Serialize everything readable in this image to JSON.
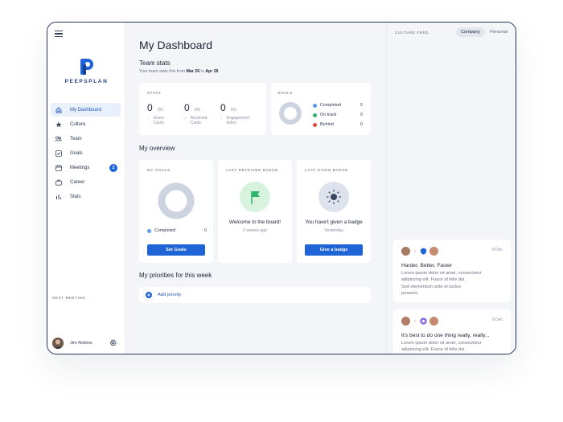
{
  "brand": {
    "name": "PEEPSPLAN"
  },
  "sidebar": {
    "items": [
      {
        "label": "My Dashboard",
        "icon": "home-icon",
        "active": true
      },
      {
        "label": "Culture",
        "icon": "star-icon"
      },
      {
        "label": "Team",
        "icon": "team-icon"
      },
      {
        "label": "Goals",
        "icon": "goals-icon"
      },
      {
        "label": "Meetings",
        "icon": "calendar-icon",
        "badge": "2"
      },
      {
        "label": "Career",
        "icon": "briefcase-icon"
      },
      {
        "label": "Stats",
        "icon": "stats-icon"
      }
    ],
    "next_meeting_label": "NEXT MEETING",
    "user_name": "Jim Robins"
  },
  "main": {
    "title": "My Dashboard",
    "team_stats": {
      "heading": "Team stats",
      "subtitle_prefix": "Your team stats this from",
      "date_from": "Mar 26",
      "date_joiner": "to",
      "date_to": "Apr 26",
      "stats_label": "STATS",
      "stats": [
        {
          "value": "0",
          "pct": "0%",
          "label_1": "Given",
          "label_2": "Cards",
          "arrow": "↑"
        },
        {
          "value": "0",
          "pct": "0%",
          "label_1": "Received",
          "label_2": "Cards",
          "arrow": "↓"
        },
        {
          "value": "0",
          "pct": "0%",
          "label_1": "Engagement",
          "label_2": "index",
          "arrow": "↓"
        }
      ],
      "goals_label": "GOALS",
      "goals_legend": [
        {
          "label": "Completed",
          "value": "0",
          "color": "#5b9be8"
        },
        {
          "label": "On track",
          "value": "0",
          "color": "#2fb36b"
        },
        {
          "label": "Behind",
          "value": "0",
          "color": "#e2493f"
        }
      ]
    },
    "overview": {
      "heading": "My overview",
      "my_goals": {
        "label": "MY GOALS",
        "legend_label": "Completed",
        "legend_value": "0",
        "button": "Set Goals"
      },
      "received": {
        "label": "LAST RECEIVED BADGE",
        "title": "Welcome to the board!",
        "time": "3 weeks ago"
      },
      "given": {
        "label": "LAST GIVEN BADGE",
        "title": "You have't given a badge",
        "time": "Yesterday",
        "button": "Give a badge"
      }
    },
    "priorities": {
      "heading": "My priorities for this week",
      "add_label": "Add priority"
    }
  },
  "feed": {
    "title": "CULTURE FEED",
    "tabs": [
      {
        "label": "Company",
        "active": true
      },
      {
        "label": "Personal"
      }
    ],
    "posts": [
      {
        "date": "8 Dec",
        "title": "Harder, Better, Faster",
        "body_1": "Lorem ipsum dolor sit amet, consectetur",
        "body_2": "adipiscing elit. Fusce id felis dui.",
        "body_3": "Sed elementum ante et luctus",
        "body_4": "posuere."
      },
      {
        "date": "8 Dec",
        "title": "It's best to do one thing really, really...",
        "body_1": "Lorem ipsum dolor sit amet, consectetur",
        "body_2": "adipiscing elit. Fusce id felis dui."
      }
    ]
  },
  "colors": {
    "accent": "#1f64d6",
    "donut": "#cdd4e0",
    "badge_green": "#2fb36b"
  }
}
